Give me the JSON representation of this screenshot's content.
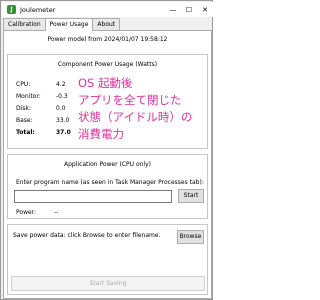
{
  "window": {
    "title": "Joulemeter",
    "icon_glyph": "J",
    "minimize_glyph": "—",
    "maximize_glyph": "☐",
    "close_glyph": "✕"
  },
  "tabs": [
    "Calibration",
    "Power Usage",
    "About"
  ],
  "active_tab": "Power Usage",
  "model_line": "Power model from 2024/01/07 19:58:12",
  "component_group": {
    "title": "Component Power Usage (Watts)",
    "rows": [
      {
        "label": "CPU:",
        "value": "4.2"
      },
      {
        "label": "Monitor:",
        "value": "-0.3"
      },
      {
        "label": "Disk:",
        "value": "0.0"
      },
      {
        "label": "Base:",
        "value": "33.0"
      },
      {
        "label": "Total:",
        "value": "37.0"
      }
    ]
  },
  "annotation": {
    "lines": [
      "OS 起動後",
      "アプリを全て閉じた",
      "状態（アイドル時）の",
      "消費電力"
    ],
    "color": "#e0309e"
  },
  "application_group": {
    "title": "Application Power (CPU only)",
    "prompt": "Enter program name (as seen in Task Manager Processes tab):",
    "input_value": "",
    "start_label": "Start",
    "power_label": "Power:",
    "power_value": "--"
  },
  "save_group": {
    "text": "Save power data: click Browse to enter filename.",
    "browse_label": "Browse",
    "start_saving_label": "Start Saving"
  }
}
